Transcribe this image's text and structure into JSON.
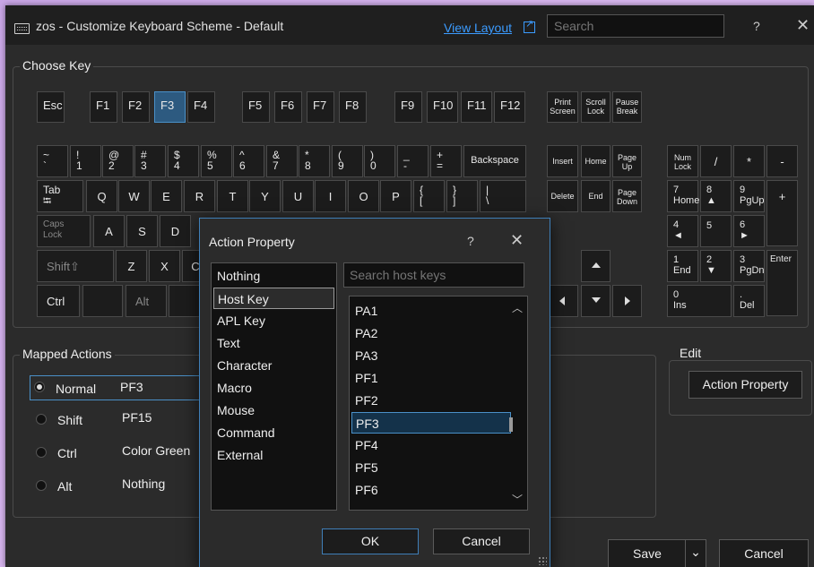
{
  "window": {
    "title": "zos - Customize Keyboard Scheme - Default",
    "view_layout": "View Layout",
    "search_placeholder": "Search",
    "help": "?",
    "close": "✕"
  },
  "choose_key": {
    "label": "Choose Key",
    "keys": [
      {
        "id": "esc",
        "label": "Esc"
      },
      {
        "id": "f1",
        "label": "F1"
      },
      {
        "id": "f2",
        "label": "F2"
      },
      {
        "id": "f3",
        "label": "F3"
      },
      {
        "id": "f4",
        "label": "F4"
      },
      {
        "id": "f5",
        "label": "F5"
      },
      {
        "id": "f6",
        "label": "F6"
      },
      {
        "id": "f7",
        "label": "F7"
      },
      {
        "id": "f8",
        "label": "F8"
      },
      {
        "id": "f9",
        "label": "F9"
      },
      {
        "id": "f10",
        "label": "F10"
      },
      {
        "id": "f11",
        "label": "F11"
      },
      {
        "id": "f12",
        "label": "F12"
      },
      {
        "id": "print-screen",
        "label": "Print\nScreen"
      },
      {
        "id": "scroll-lock",
        "label": "Scroll\nLock"
      },
      {
        "id": "pause-break",
        "label": "Pause\nBreak"
      },
      {
        "id": "tilde",
        "label": "~\n`"
      },
      {
        "id": "1",
        "label": "!\n1"
      },
      {
        "id": "2",
        "label": "@\n2"
      },
      {
        "id": "3",
        "label": "#\n3"
      },
      {
        "id": "4",
        "label": "$\n4"
      },
      {
        "id": "5",
        "label": "%\n5"
      },
      {
        "id": "6",
        "label": "^\n6"
      },
      {
        "id": "7",
        "label": "&\n7"
      },
      {
        "id": "8",
        "label": "*\n8"
      },
      {
        "id": "9",
        "label": "(\n9"
      },
      {
        "id": "0",
        "label": ")\n0"
      },
      {
        "id": "minus",
        "label": "_\n-"
      },
      {
        "id": "equals",
        "label": "+\n="
      },
      {
        "id": "backspace",
        "label": "Backspace"
      },
      {
        "id": "insert",
        "label": "Insert"
      },
      {
        "id": "home",
        "label": "Home"
      },
      {
        "id": "page-up",
        "label": "Page\nUp"
      },
      {
        "id": "num-lock",
        "label": "Num\nLock"
      },
      {
        "id": "num-divide",
        "label": "/"
      },
      {
        "id": "num-multiply",
        "label": "*"
      },
      {
        "id": "num-minus",
        "label": "-"
      },
      {
        "id": "tab",
        "label": "Tab\n⭾"
      },
      {
        "id": "q",
        "label": "Q"
      },
      {
        "id": "w",
        "label": "W"
      },
      {
        "id": "e",
        "label": "E"
      },
      {
        "id": "r",
        "label": "R"
      },
      {
        "id": "t",
        "label": "T"
      },
      {
        "id": "y",
        "label": "Y"
      },
      {
        "id": "u",
        "label": "U"
      },
      {
        "id": "i",
        "label": "I"
      },
      {
        "id": "o",
        "label": "O"
      },
      {
        "id": "p",
        "label": "P"
      },
      {
        "id": "lbrace",
        "label": "{\n["
      },
      {
        "id": "rbrace",
        "label": "}\n]"
      },
      {
        "id": "pipe",
        "label": "|\n\\"
      },
      {
        "id": "delete",
        "label": "Delete"
      },
      {
        "id": "end",
        "label": "End"
      },
      {
        "id": "page-down",
        "label": "Page\nDown"
      },
      {
        "id": "num7",
        "label": "7\nHome"
      },
      {
        "id": "num8",
        "label": "8\n▲"
      },
      {
        "id": "num9",
        "label": "9\nPgUp"
      },
      {
        "id": "num-plus",
        "label": "+"
      },
      {
        "id": "caps-lock",
        "label": "Caps\nLock"
      },
      {
        "id": "a",
        "label": "A"
      },
      {
        "id": "s",
        "label": "S"
      },
      {
        "id": "d",
        "label": "D"
      },
      {
        "id": "num4",
        "label": "4\n◄"
      },
      {
        "id": "num5",
        "label": "5"
      },
      {
        "id": "num6",
        "label": "6\n►"
      },
      {
        "id": "shift",
        "label": "Shift⇧"
      },
      {
        "id": "z",
        "label": "Z"
      },
      {
        "id": "x",
        "label": "X"
      },
      {
        "id": "c",
        "label": "C"
      },
      {
        "id": "num1",
        "label": "1\nEnd"
      },
      {
        "id": "num2",
        "label": "2\n▼"
      },
      {
        "id": "num3",
        "label": "3\nPgDn"
      },
      {
        "id": "num-enter",
        "label": "Enter"
      },
      {
        "id": "ctrl",
        "label": "Ctrl"
      },
      {
        "id": "alt",
        "label": "Alt"
      },
      {
        "id": "num0",
        "label": "0\nIns"
      },
      {
        "id": "num-del",
        "label": ".\nDel"
      }
    ]
  },
  "mapped_actions": {
    "label": "Mapped Actions",
    "rows": [
      {
        "mod": "Normal",
        "value": "PF3",
        "selected": true
      },
      {
        "mod": "Shift",
        "value": "PF15",
        "selected": false
      },
      {
        "mod": "Ctrl",
        "value": "Color Green",
        "selected": false
      },
      {
        "mod": "Alt",
        "value": "Nothing",
        "selected": false
      }
    ]
  },
  "edit": {
    "label": "Edit",
    "action_property": "Action Property"
  },
  "footer": {
    "save": "Save",
    "save_dropdown": "⌄",
    "cancel": "Cancel"
  },
  "dialog": {
    "title": "Action Property",
    "help": "?",
    "close": "✕",
    "types": [
      "Nothing",
      "Host Key",
      "APL Key",
      "Text",
      "Character",
      "Macro",
      "Mouse",
      "Command",
      "External"
    ],
    "selected_type": "Host Key",
    "search_placeholder": "Search host keys",
    "host_keys": [
      "PA1",
      "PA2",
      "PA3",
      "PF1",
      "PF2",
      "PF3",
      "PF4",
      "PF5",
      "PF6"
    ],
    "selected_host_key": "PF3",
    "ok": "OK",
    "cancel": "Cancel"
  },
  "colors": {
    "accent": "#3b9bff",
    "selection": "#2d5a80",
    "background": "#2b2b2b"
  }
}
